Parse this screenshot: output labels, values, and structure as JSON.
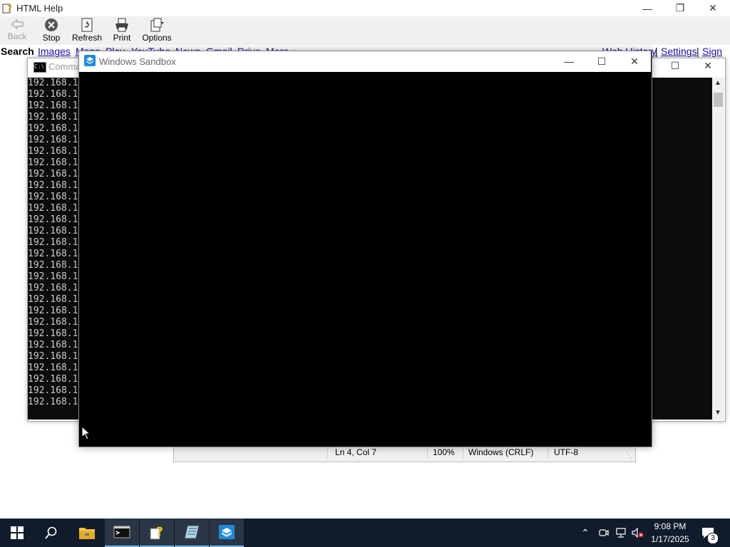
{
  "help": {
    "title": "HTML Help",
    "toolbar": {
      "back": "Back",
      "stop": "Stop",
      "refresh": "Refresh",
      "print": "Print",
      "options": "Options"
    },
    "nav": {
      "search": "Search",
      "images": "Images",
      "maps": "Maps",
      "play": "Play",
      "youtube": "YouTube",
      "news": "News",
      "gmail": "Gmail",
      "drive": "Drive",
      "more": "More »",
      "web_history": "Web History",
      "sep1": "|",
      "settings": "Settings",
      "sep2": "|",
      "sign_in": "Sign in"
    }
  },
  "cmd": {
    "title": "Comma",
    "line_text": "192.168.1",
    "line_count": 29
  },
  "sandbox": {
    "title": "Windows Sandbox"
  },
  "notepad_status": {
    "position": "Ln 4, Col 7",
    "zoom": "100%",
    "line_ending": "Windows (CRLF)",
    "encoding": "UTF-8"
  },
  "taskbar": {
    "time": "9:08 PM",
    "date": "1/17/2025",
    "notification_count": "3",
    "accent": "#76b9ed",
    "background": "#101c2c"
  }
}
